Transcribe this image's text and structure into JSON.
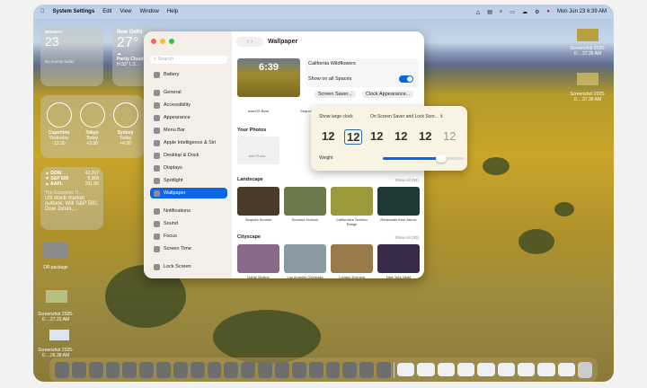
{
  "menubar": {
    "app": "System Settings",
    "items": [
      "Edit",
      "View",
      "Window",
      "Help"
    ],
    "clock": "Mon Jun 23  6:39 AM"
  },
  "widgets": {
    "calendar": {
      "day": "MONDAY",
      "date": "23",
      "events": "No events today"
    },
    "weather": {
      "city": "New Delhi",
      "temp": "27°",
      "cond": "Partly Cloudy",
      "hl": "H:33° L:2…"
    },
    "clocks": [
      {
        "city": "Cupertino",
        "day": "Yesterday",
        "off": "-12:30"
      },
      {
        "city": "Tokyo",
        "day": "Today",
        "off": "+3:30"
      },
      {
        "city": "Sydney",
        "day": "Today",
        "off": "+4:30"
      }
    ],
    "stocks": [
      {
        "sym": "▲ DOW",
        "val": "42,207"
      },
      {
        "sym": "▼ S&P 500",
        "val": "5,968"
      },
      {
        "sym": "▲ AAPL",
        "val": "201.00"
      }
    ],
    "news": {
      "source": "The Economic Ti…",
      "headline": "US stock market outlook: Will S&P 500, Dow Jones,..."
    }
  },
  "desktop": {
    "icons": [
      {
        "label": "DR.package"
      },
      {
        "label": "Screenshot 2025-0….27.22 AM"
      },
      {
        "label": "Screenshot 2025-0….26.38 AM"
      },
      {
        "label": "Screenshot 2025-0….37.35 AM"
      },
      {
        "label": "Screenshot 2025-0….37.30 AM"
      }
    ]
  },
  "settings": {
    "search_placeholder": "Search",
    "sidebar": [
      "Battery",
      "General",
      "Accessibility",
      "Appearance",
      "Menu Bar",
      "Apple Intelligence & Siri",
      "Desktop & Dock",
      "Displays",
      "Spotlight",
      "Wallpaper",
      "Notifications",
      "Sound",
      "Focus",
      "Screen Time",
      "Lock Screen"
    ],
    "title": "Wallpaper",
    "preview_time": "6:39",
    "wallpaper_name": "California Wildflowers",
    "show_all_spaces": "Show on all Spaces",
    "show_all_spaces_on": true,
    "screen_saver_btn": "Screen Saver...",
    "clock_btn": "Clock Appearance...",
    "row_captions": [
      "macOS Beta",
      "Sequoia"
    ],
    "your_photos": "Your Photos",
    "add_photo": "Add Photo...",
    "landscape": {
      "title": "Landscape",
      "show_all": "Show All (84)",
      "items": [
        "Sequoia Sunrise",
        "Sonoma Horizon",
        "California's Temblor Range",
        "Redwoods from Above"
      ]
    },
    "cityscape": {
      "title": "Cityscape",
      "show_all": "Show All (30)",
      "items": [
        "Dubai Skyline",
        "Los Angeles Overpass",
        "London Evening",
        "New York Night"
      ]
    }
  },
  "popover": {
    "label": "Show large clock",
    "option": "On Screen Saver and Lock Scre...",
    "clock_samples": [
      "12",
      "12",
      "12",
      "12",
      "12",
      "12"
    ],
    "selected": 1,
    "weight_label": "Weight",
    "weight": 0.72
  },
  "colors": {
    "accent": "#0a66e4"
  }
}
